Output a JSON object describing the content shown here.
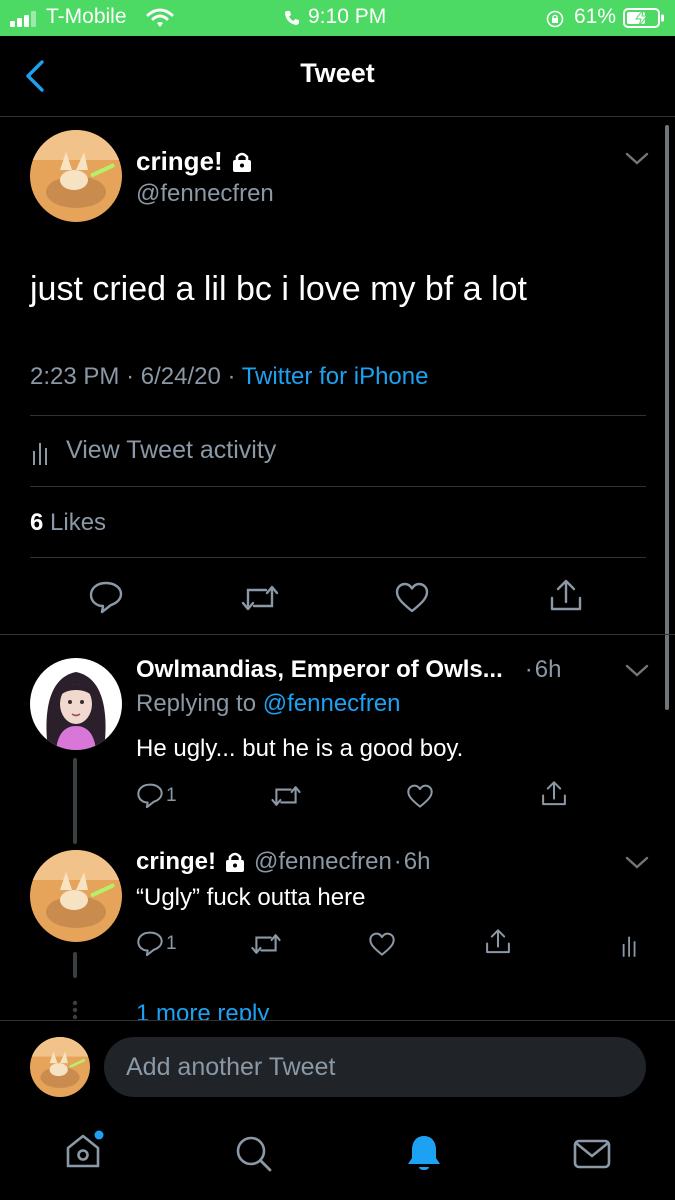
{
  "status_bar": {
    "carrier": "T-Mobile",
    "time": "9:10 PM",
    "battery": "61%"
  },
  "nav": {
    "title": "Tweet",
    "back_icon": "chevron-left-icon"
  },
  "tweet": {
    "display_name": "cringe!",
    "handle": "@fennecfren",
    "text": "just cried a lil bc i love my bf a lot",
    "time": "2:23 PM",
    "date": "6/24/20",
    "source": "Twitter for iPhone",
    "activity_label": "View Tweet activity",
    "likes_count": "6",
    "likes_label": "Likes"
  },
  "replies": [
    {
      "display_name": "Owlmandias, Emperor of Owls...",
      "age": "6h",
      "replying_prefix": "Replying to",
      "replying_to": "@fennecfren",
      "text": "He ugly... but he is a good boy.",
      "reply_count": "1"
    },
    {
      "display_name": "cringe!",
      "handle": "@fennecfren",
      "age": "6h",
      "text": "“Ugly” fuck outta here",
      "reply_count": "1"
    }
  ],
  "more_replies": "1 more reply",
  "compose": {
    "placeholder": "Add another Tweet"
  },
  "colors": {
    "accent": "#1da1f2",
    "status_bar": "#4cd964",
    "muted": "#8b98a5"
  }
}
